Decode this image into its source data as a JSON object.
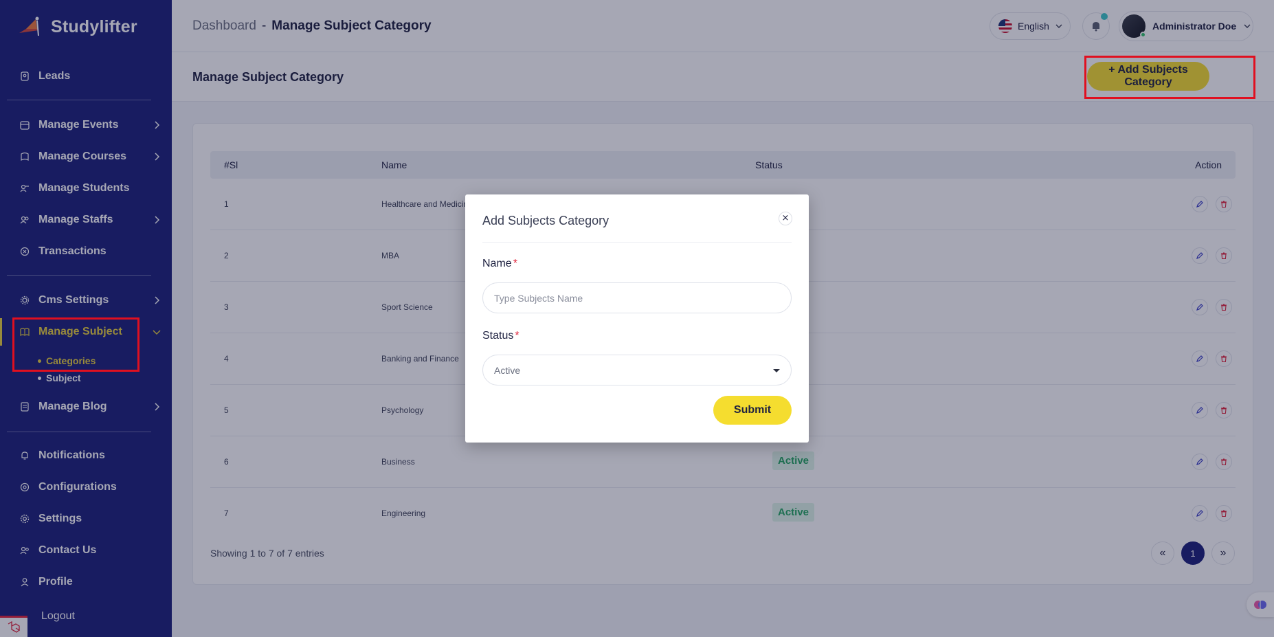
{
  "brand": {
    "name": "Studylifter"
  },
  "sidebar": {
    "items": [
      {
        "label": "Leads",
        "icon": "user-badge-icon"
      },
      {
        "label": "Manage Events",
        "icon": "calendar-icon"
      },
      {
        "label": "Manage Courses",
        "icon": "book-icon"
      },
      {
        "label": "Manage Students",
        "icon": "students-icon"
      },
      {
        "label": "Manage Staffs",
        "icon": "users-icon"
      },
      {
        "label": "Transactions",
        "icon": "transaction-icon"
      },
      {
        "label": "Cms Settings",
        "icon": "gears-icon"
      },
      {
        "label": "Manage Subject",
        "icon": "open-book-icon"
      },
      {
        "label": "Manage Blog",
        "icon": "blog-icon"
      },
      {
        "label": "Notifications",
        "icon": "bell-icon"
      },
      {
        "label": "Configurations",
        "icon": "config-icon"
      },
      {
        "label": "Settings",
        "icon": "gear-icon"
      },
      {
        "label": "Contact Us",
        "icon": "contacts-icon"
      },
      {
        "label": "Profile",
        "icon": "profile-icon"
      },
      {
        "label": "Logout",
        "icon": "logout-icon"
      }
    ],
    "subject_children": [
      "Categories",
      "Subject"
    ],
    "accent_color": "#e8d13c",
    "background_color": "#1a1f7a"
  },
  "header": {
    "breadcrumb_home": "Dashboard",
    "breadcrumb_sep": "-",
    "breadcrumb_current": "Manage Subject Category",
    "language": "English",
    "user_name": "Administrator Doe"
  },
  "page": {
    "title": "Manage Subject Category",
    "add_button": "+ Add Subjects Category"
  },
  "table": {
    "columns": [
      "#Sl",
      "Name",
      "Status",
      "Action"
    ],
    "rows": [
      {
        "sl": "1",
        "name": "Healthcare and Medicine",
        "status": ""
      },
      {
        "sl": "2",
        "name": "MBA",
        "status": ""
      },
      {
        "sl": "3",
        "name": "Sport Science",
        "status": ""
      },
      {
        "sl": "4",
        "name": "Banking and Finance",
        "status": ""
      },
      {
        "sl": "5",
        "name": "Psychology",
        "status": ""
      },
      {
        "sl": "6",
        "name": "Business",
        "status": "Active"
      },
      {
        "sl": "7",
        "name": "Engineering",
        "status": "Active"
      }
    ],
    "showing": "Showing 1 to 7 of 7 entries",
    "pagination": {
      "prev": "«",
      "current": "1",
      "next": "»"
    }
  },
  "modal": {
    "title": "Add Subjects Category",
    "close": "×",
    "name_label": "Name",
    "name_placeholder": "Type Subjects Name",
    "name_value": "",
    "status_label": "Status",
    "required_mark": "*",
    "status_value": "Active",
    "submit": "Submit"
  },
  "colors": {
    "primary_button": "#f5dd2f",
    "highlight_box": "#e01020",
    "status_active": "#23a560"
  }
}
